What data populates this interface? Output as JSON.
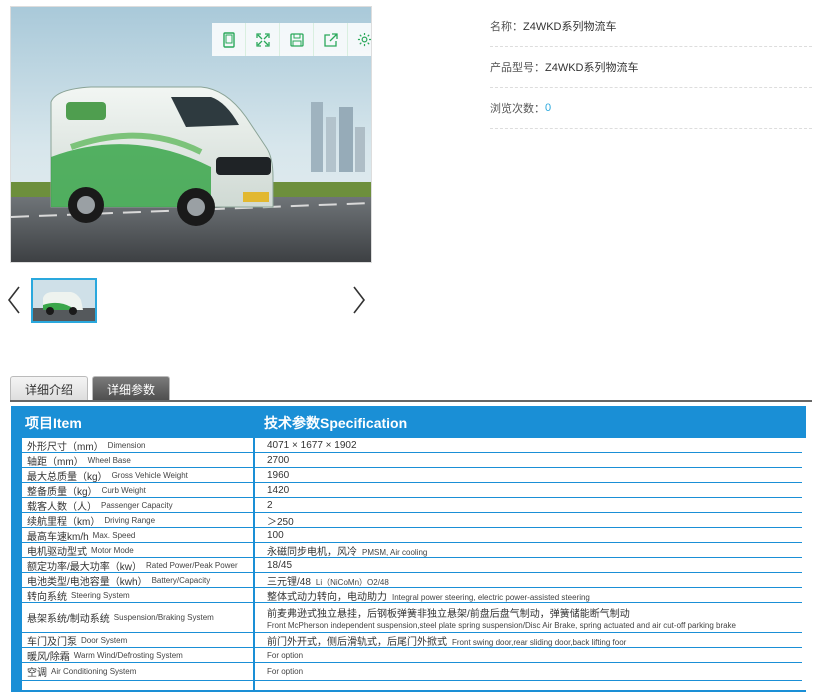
{
  "toolbar": {
    "icons": [
      "tablet-icon",
      "fullscreen-icon",
      "save-icon",
      "share-icon",
      "gear-icon"
    ]
  },
  "gallery": {
    "prev_label": "‹",
    "next_label": "›"
  },
  "info": {
    "name_label": "名称：",
    "name_value": "Z4WKD系列物流车",
    "model_label": "产品型号：",
    "model_value": "Z4WKD系列物流车",
    "views_label": "浏览次数：",
    "views_value": "0"
  },
  "tabs": [
    {
      "label": "详细介绍",
      "active": false
    },
    {
      "label": "详细参数",
      "active": true
    }
  ],
  "spec": {
    "header_item": "项目Item",
    "header_spec": "技术参数Specification",
    "rows": [
      {
        "cn": "外形尺寸（mm）",
        "en": "Dimension",
        "value": "4071 × 1677 × 1902",
        "value_en": ""
      },
      {
        "cn": "轴距（mm）",
        "en": "Wheel Base",
        "value": "2700",
        "value_en": ""
      },
      {
        "cn": "最大总质量（kg）",
        "en": "Gross Vehicle Weight",
        "value": "1960",
        "value_en": ""
      },
      {
        "cn": "整备质量（kg）",
        "en": "Curb Weight",
        "value": "1420",
        "value_en": ""
      },
      {
        "cn": "载客人数（人）",
        "en": "Passenger Capacity",
        "value": "2",
        "value_en": ""
      },
      {
        "cn": "续航里程（km）",
        "en": "Driving Range",
        "value": "＞250",
        "value_en": ""
      },
      {
        "cn": "最高车速km/h",
        "en": "Max. Speed",
        "value": "100",
        "value_en": ""
      },
      {
        "cn": "电机驱动型式",
        "en": "Motor Mode",
        "value": "永磁同步电机，风冷",
        "value_en": "PMSM, Air cooling"
      },
      {
        "cn": "额定功率/最大功率（kw）",
        "en": "Rated Power/Peak Power",
        "value": "18/45",
        "value_en": ""
      },
      {
        "cn": "电池类型/电池容量（kwh）",
        "en": "Battery/Capacity",
        "value": "三元锂/48",
        "value_en": "Li（NiCoMn）O2/48"
      },
      {
        "cn": "转向系统",
        "en": "Steering System",
        "value": "整体式动力转向，电动助力",
        "value_en": "Integral power steering, electric power-assisted steering"
      },
      {
        "cn": "悬架系统/制动系统",
        "en": "Suspension/Braking System",
        "value": "前麦弗逊式独立悬挂，后钢板弹簧非独立悬架/前盘后盘气制动，弹簧储能断气制动",
        "value_en": "Front McPherson independent suspension,steel plate spring suspension/Disc Air Brake, spring actuated and air cut-off parking brake"
      },
      {
        "cn": "车门及门泵",
        "en": "Door System",
        "value": "前门外开式，侧后滑轨式，后尾门外掀式",
        "value_en": "Front swing door,rear sliding door,back lifting foor"
      },
      {
        "cn": "暖风/除霜",
        "en": "Warm Wind/Defrosting System",
        "value": "",
        "value_en": "For option"
      },
      {
        "cn": "空调",
        "en": "Air Conditioning System",
        "value": "",
        "value_en": "For option"
      }
    ]
  }
}
